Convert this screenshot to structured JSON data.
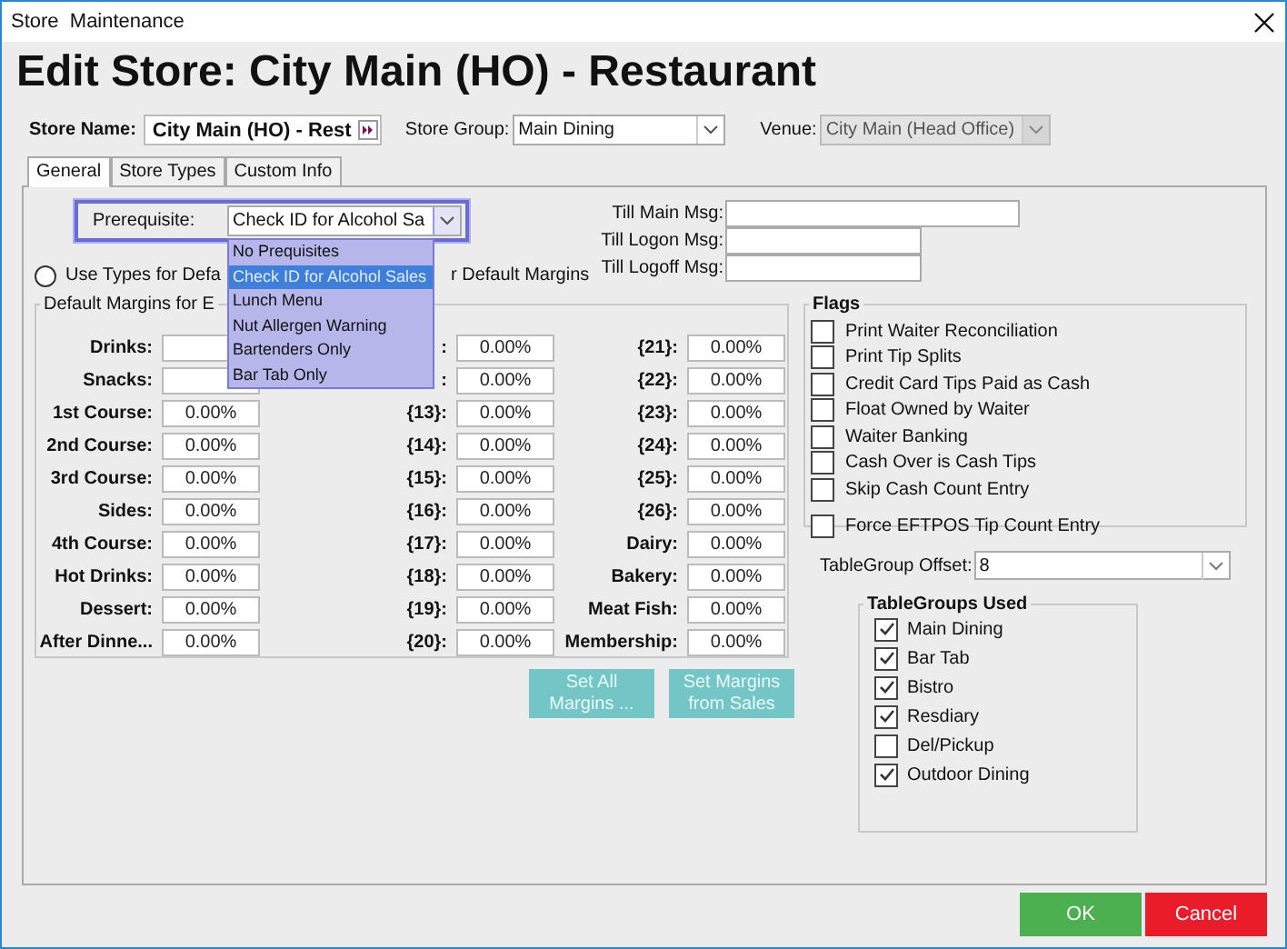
{
  "window": {
    "title": "Store  Maintenance"
  },
  "heading": "Edit Store: City Main (HO) - Restaurant",
  "store_name": {
    "label": "Store Name:",
    "value": "City Main (HO) - Rest"
  },
  "store_group": {
    "label": "Store Group:",
    "value": "Main Dining"
  },
  "venue": {
    "label": "Venue:",
    "value": "City Main (Head Office)",
    "disabled": true
  },
  "tabs": [
    {
      "label": "General",
      "selected": true
    },
    {
      "label": "Store Types",
      "selected": false
    },
    {
      "label": "Custom Info",
      "selected": false
    }
  ],
  "prerequisite": {
    "label": "Prerequisite:",
    "value": "Check ID for Alcohol Sa",
    "expanded": true,
    "options": [
      {
        "label": "No Prequisites",
        "selected": false
      },
      {
        "label": "Check ID for Alcohol Sales",
        "selected": true
      },
      {
        "label": "Lunch Menu",
        "selected": false
      },
      {
        "label": "Nut Allergen Warning",
        "selected": false
      },
      {
        "label": "Bartenders Only",
        "selected": false
      },
      {
        "label": "Bar Tab Only",
        "selected": false
      }
    ]
  },
  "margin_mode": {
    "option": {
      "label": "Use Types for Defa",
      "selected": false
    },
    "trailing_text": "r Default Margins"
  },
  "till_messages": [
    {
      "label": "Till Main Msg:"
    },
    {
      "label": "Till Logon Msg:"
    },
    {
      "label": "Till Logoff Msg:"
    }
  ],
  "default_margins": {
    "title": "Default Margins for E",
    "columns": [
      [
        {
          "label": "Drinks:"
        },
        {
          "label": "Snacks:"
        },
        {
          "label": "1st Course:",
          "value": "0.00%"
        },
        {
          "label": "2nd Course:",
          "value": "0.00%"
        },
        {
          "label": "3rd Course:",
          "value": "0.00%"
        },
        {
          "label": "Sides:",
          "value": "0.00%"
        },
        {
          "label": "4th Course:",
          "value": "0.00%"
        },
        {
          "label": "Hot Drinks:",
          "value": "0.00%"
        },
        {
          "label": "Dessert:",
          "value": "0.00%"
        },
        {
          "label": "After Dinne...",
          "value": "0.00%"
        }
      ],
      [
        {
          "label": ":",
          "value": "0.00%"
        },
        {
          "label": ":",
          "value": "0.00%"
        },
        {
          "label": "{13}:",
          "value": "0.00%"
        },
        {
          "label": "{14}:",
          "value": "0.00%"
        },
        {
          "label": "{15}:",
          "value": "0.00%"
        },
        {
          "label": "{16}:",
          "value": "0.00%"
        },
        {
          "label": "{17}:",
          "value": "0.00%"
        },
        {
          "label": "{18}:",
          "value": "0.00%"
        },
        {
          "label": "{19}:",
          "value": "0.00%"
        },
        {
          "label": "{20}:",
          "value": "0.00%"
        }
      ],
      [
        {
          "label": "{21}:",
          "value": "0.00%"
        },
        {
          "label": "{22}:",
          "value": "0.00%"
        },
        {
          "label": "{23}:",
          "value": "0.00%"
        },
        {
          "label": "{24}:",
          "value": "0.00%"
        },
        {
          "label": "{25}:",
          "value": "0.00%"
        },
        {
          "label": "{26}:",
          "value": "0.00%"
        },
        {
          "label": "Dairy:",
          "value": "0.00%"
        },
        {
          "label": "Bakery:",
          "value": "0.00%"
        },
        {
          "label": "Meat  Fish:",
          "value": "0.00%"
        },
        {
          "label": "Membership:",
          "value": "0.00%"
        }
      ]
    ]
  },
  "margin_buttons": [
    "Set All Margins ...",
    "Set Margins from Sales"
  ],
  "flags": {
    "title": "Flags",
    "items": [
      {
        "label": "Print Waiter Reconciliation",
        "checked": false
      },
      {
        "label": "Print Tip Splits",
        "checked": false
      },
      {
        "label": "Credit Card Tips Paid as Cash",
        "checked": false
      },
      {
        "label": "Float Owned by Waiter",
        "checked": false
      },
      {
        "label": "Waiter Banking",
        "checked": false
      },
      {
        "label": "Cash Over is Cash Tips",
        "checked": false
      },
      {
        "label": "Skip Cash Count Entry",
        "checked": false
      },
      {
        "label": "Force EFTPOS Tip Count Entry",
        "checked": false
      }
    ]
  },
  "tablegroup_offset": {
    "label": "TableGroup Offset:",
    "value": "8"
  },
  "tablegroups_used": {
    "title": "TableGroups Used",
    "items": [
      {
        "label": "Main Dining",
        "checked": true
      },
      {
        "label": "Bar Tab",
        "checked": true
      },
      {
        "label": "Bistro",
        "checked": true
      },
      {
        "label": "Resdiary",
        "checked": true
      },
      {
        "label": "Del/Pickup",
        "checked": false
      },
      {
        "label": "Outdoor Dining",
        "checked": true
      }
    ]
  },
  "buttons": [
    {
      "label": "OK",
      "kind": "ok"
    },
    {
      "label": "Cancel",
      "kind": "cancel"
    }
  ]
}
